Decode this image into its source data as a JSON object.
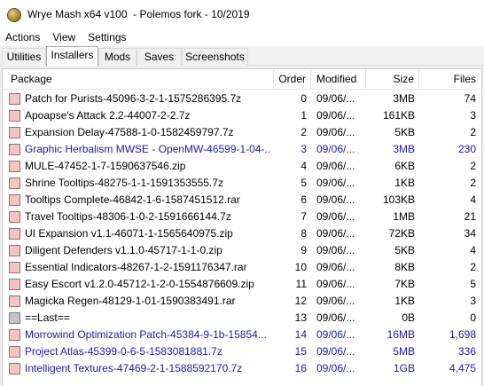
{
  "window": {
    "title": "Wrye Mash x64 v100  - Polemos fork - 10/2019"
  },
  "menu": [
    "Actions",
    "View",
    "Settings"
  ],
  "tabs": [
    {
      "label": "Utilities",
      "active": false
    },
    {
      "label": "Installers",
      "active": true
    },
    {
      "label": "Mods",
      "active": false
    },
    {
      "label": "Saves",
      "active": false
    },
    {
      "label": "Screenshots",
      "active": false
    }
  ],
  "columns": {
    "package": "Package",
    "order": "Order",
    "modified": "Modified",
    "size": "Size",
    "files": "Files"
  },
  "colors": {
    "installed_text": "#000000",
    "highlight_text": "#1a1aa8",
    "checkbox_fill": "#f2c4c4",
    "marker_fill": "#c4c4c4"
  },
  "rows": [
    {
      "package": "Patch for Purists-45096-3-2-1-1575286395.7z",
      "order": "0",
      "modified": "09/06/...",
      "size": "3MB",
      "files": "74",
      "blue": false,
      "marker": false
    },
    {
      "package": "Apoapse's Attack 2.2-44007-2-2.7z",
      "order": "1",
      "modified": "09/06/...",
      "size": "161KB",
      "files": "3",
      "blue": false,
      "marker": false
    },
    {
      "package": "Expansion Delay-47588-1-0-1582459797.7z",
      "order": "2",
      "modified": "09/06/...",
      "size": "5KB",
      "files": "2",
      "blue": false,
      "marker": false
    },
    {
      "package": "Graphic Herbalism MWSE - OpenMW-46599-1-04-...",
      "order": "3",
      "modified": "09/06/...",
      "size": "3MB",
      "files": "230",
      "blue": true,
      "marker": false
    },
    {
      "package": "MULE-47452-1-7-1590637546.zip",
      "order": "4",
      "modified": "09/06/...",
      "size": "6KB",
      "files": "2",
      "blue": false,
      "marker": false
    },
    {
      "package": "Shrine Tooltips-48275-1-1-1591353555.7z",
      "order": "5",
      "modified": "09/06/...",
      "size": "1KB",
      "files": "2",
      "blue": false,
      "marker": false
    },
    {
      "package": "Tooltips Complete-46842-1-6-1587451512.rar",
      "order": "6",
      "modified": "09/06/...",
      "size": "103KB",
      "files": "4",
      "blue": false,
      "marker": false
    },
    {
      "package": "Travel Tooltips-48306-1-0-2-1591666144.7z",
      "order": "7",
      "modified": "09/06/...",
      "size": "1MB",
      "files": "21",
      "blue": false,
      "marker": false
    },
    {
      "package": "UI Expansion v1.1-46071-1-1565640975.zip",
      "order": "8",
      "modified": "09/06/...",
      "size": "72KB",
      "files": "34",
      "blue": false,
      "marker": false
    },
    {
      "package": "Diligent Defenders v1.1.0-45717-1-1-0.zip",
      "order": "9",
      "modified": "09/06/...",
      "size": "5KB",
      "files": "4",
      "blue": false,
      "marker": false
    },
    {
      "package": "Essential Indicators-48267-1-2-1591176347.rar",
      "order": "10",
      "modified": "09/06/...",
      "size": "8KB",
      "files": "2",
      "blue": false,
      "marker": false
    },
    {
      "package": "Easy Escort v1.2.0-45712-1-2-0-1554876609.zip",
      "order": "11",
      "modified": "09/06/...",
      "size": "7KB",
      "files": "5",
      "blue": false,
      "marker": false
    },
    {
      "package": "Magicka Regen-48129-1-01-1590383491.rar",
      "order": "12",
      "modified": "09/06/...",
      "size": "1KB",
      "files": "3",
      "blue": false,
      "marker": false
    },
    {
      "package": "==Last==",
      "order": "13",
      "modified": "09/06/...",
      "size": "0B",
      "files": "0",
      "blue": false,
      "marker": true
    },
    {
      "package": "Morrowind Optimization Patch-45384-9-1b-15854...",
      "order": "14",
      "modified": "09/06/...",
      "size": "16MB",
      "files": "1,698",
      "blue": true,
      "marker": false
    },
    {
      "package": "Project Atlas-45399-0-6-5-1583081881.7z",
      "order": "15",
      "modified": "09/06/...",
      "size": "5MB",
      "files": "336",
      "blue": true,
      "marker": false
    },
    {
      "package": "Intelligent Textures-47469-2-1-1588592170.7z",
      "order": "16",
      "modified": "09/06/...",
      "size": "1GB",
      "files": "4,475",
      "blue": true,
      "marker": false
    }
  ]
}
